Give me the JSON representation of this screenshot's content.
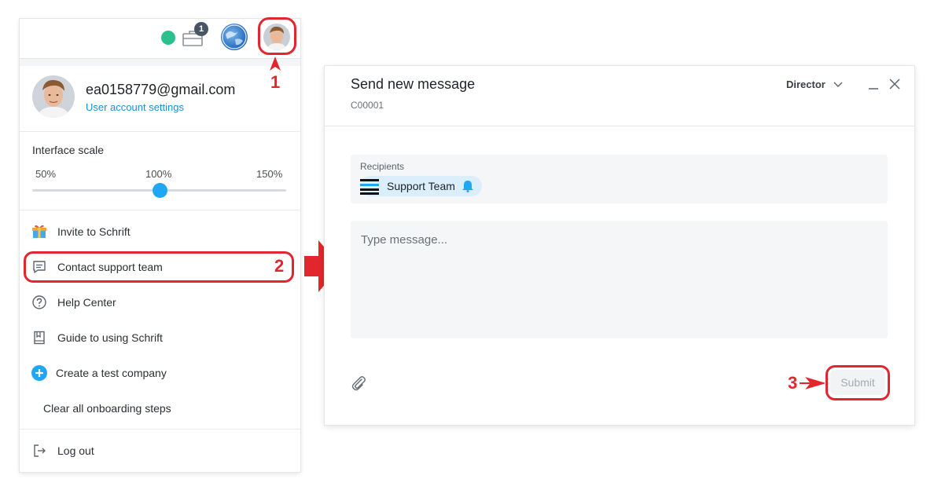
{
  "topbar": {
    "notification_count": "1",
    "icons": [
      "status-dot",
      "briefcase-icon",
      "company-globe-avatar",
      "user-avatar"
    ]
  },
  "user": {
    "email": "ea0158779@gmail.com",
    "settings_link": "User account settings"
  },
  "interface_scale": {
    "title": "Interface scale",
    "labels": [
      "50%",
      "100%",
      "150%"
    ],
    "value": "100%"
  },
  "menu": {
    "items": [
      {
        "label": "Invite to Schrift",
        "icon": "gift-icon"
      },
      {
        "label": "Contact support team",
        "icon": "chat-icon"
      },
      {
        "label": "Help Center",
        "icon": "help-circle-icon"
      },
      {
        "label": "Guide to using Schrift",
        "icon": "book-icon"
      },
      {
        "label": "Create a test company",
        "icon": "plus-circle-icon"
      },
      {
        "label": "Clear all onboarding steps",
        "icon": ""
      },
      {
        "label": "Log out",
        "icon": "logout-icon"
      }
    ]
  },
  "annotations": {
    "step1": "1",
    "step2": "2",
    "step3": "3",
    "color": "#e3262e"
  },
  "dialog": {
    "title": "Send new message",
    "code": "C00001",
    "role": "Director",
    "recipients_label": "Recipients",
    "recipient_chip": "Support Team",
    "message_placeholder": "Type message...",
    "submit_label": "Submit"
  },
  "colors": {
    "accent_blue": "#1ea7f2",
    "link_blue": "#1a8fd6",
    "status_green": "#2bc08d",
    "annotation_red": "#e3262e",
    "chip_bg": "#dbeefb"
  }
}
